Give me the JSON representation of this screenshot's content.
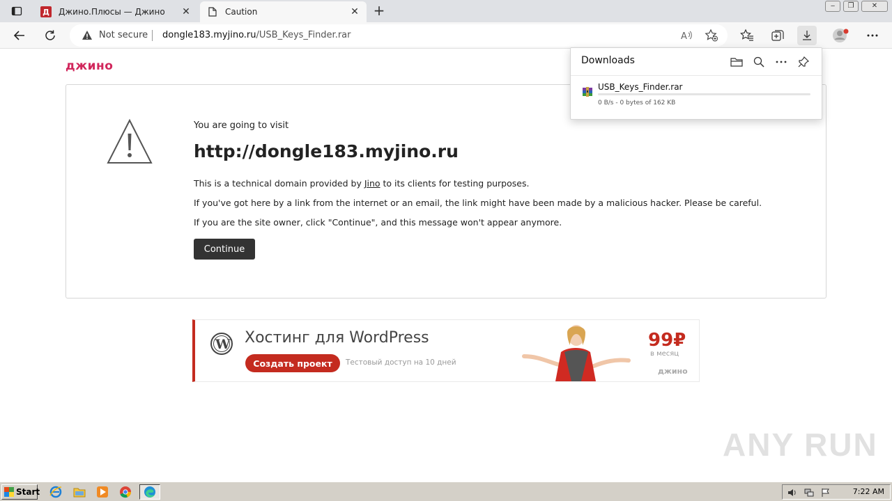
{
  "browser": {
    "tabs": [
      {
        "label": "Джино.Плюсы — Джино",
        "favicon_letter": "Д",
        "active": false
      },
      {
        "label": "Caution",
        "active": true
      }
    ],
    "new_tab_label": "+",
    "close_glyph": "✕"
  },
  "addressbar": {
    "security_label": "Not secure",
    "url_host": "dongle183.myjino.ru",
    "url_path": "/USB_Keys_Finder.rar"
  },
  "page": {
    "brand": "джино",
    "visit_label": "You are going to visit",
    "domain": "http://dongle183.myjino.ru",
    "line1_before": "This is a technical domain provided by ",
    "line1_link": "Jino",
    "line1_after": " to its clients for testing purposes.",
    "line2": "If you've got here by a link from the internet or an email, the link might have been made by a malicious hacker. Please be careful.",
    "line3": "If you are the site owner, click \"Continue\", and this message won't appear anymore.",
    "continue_label": "Continue"
  },
  "banner": {
    "title": "Хостинг для WordPress",
    "button_label": "Создать проект",
    "subtitle": "Тестовый доступ на 10 дней",
    "price": "99₽",
    "price_period": "в месяц",
    "brand": "джино"
  },
  "downloads": {
    "title": "Downloads",
    "items": [
      {
        "filename": "USB_Keys_Finder.rar",
        "status": "0 B/s - 0 bytes of 162 KB",
        "progress": 0.0
      }
    ]
  },
  "watermark": "ANY RUN",
  "taskbar": {
    "start_label": "Start",
    "clock": "7:22 AM"
  },
  "colors": {
    "brand_pink": "#d1275c",
    "jino_red": "#c42b1f",
    "continue_bg": "#333333",
    "progress_blue": "#0067c0"
  }
}
